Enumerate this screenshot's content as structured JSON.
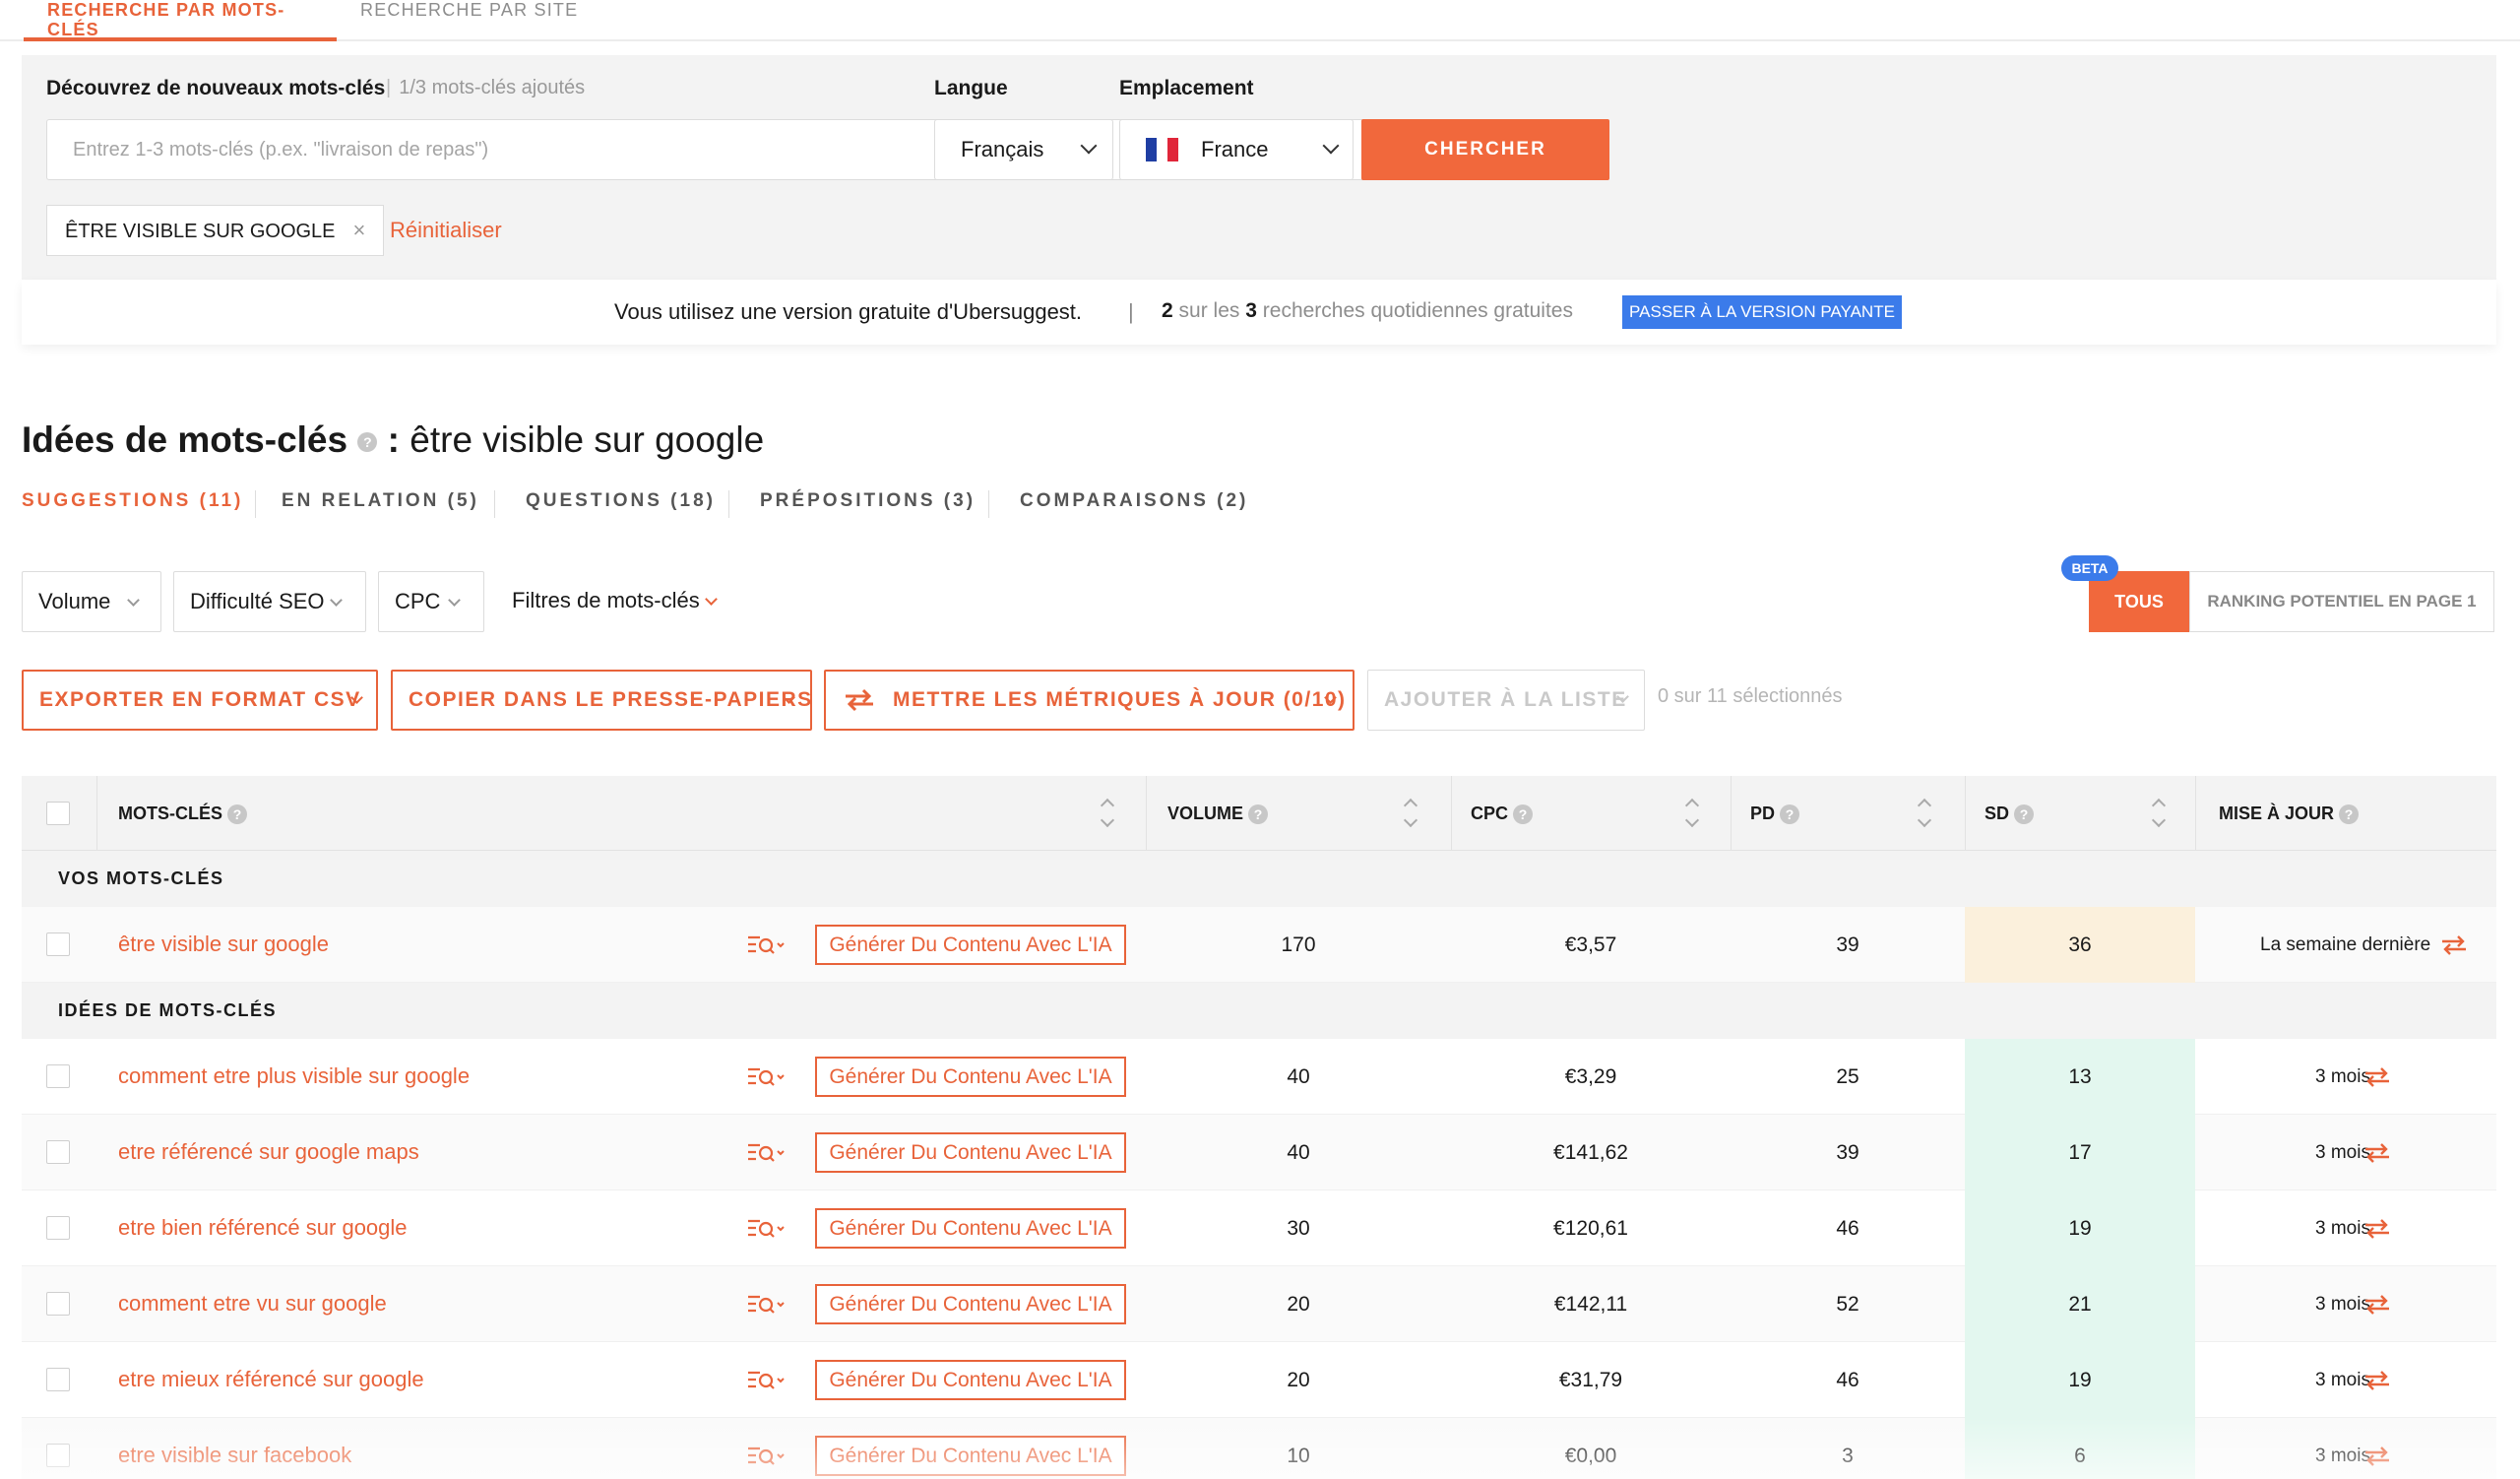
{
  "top_tabs": {
    "keywords": "RECHERCHE PAR MOTS-CLÉS",
    "site": "RECHERCHE PAR SITE"
  },
  "search": {
    "title": "Découvrez de nouveaux mots-clés",
    "count": "1/3 mots-clés ajoutés",
    "placeholder": "Entrez 1-3 mots-clés (p.ex. \"livraison de repas\")",
    "language_label": "Langue",
    "language_value": "Français",
    "location_label": "Emplacement",
    "location_value": "France",
    "search_button": "CHERCHER",
    "tag": "ÊTRE VISIBLE SUR GOOGLE",
    "tag_remove": "×",
    "reset": "Réinitialiser"
  },
  "free_bar": {
    "message": "Vous utilisez une version gratuite d'Ubersuggest.",
    "separator": "|",
    "used": "2",
    "on_the": "sur les",
    "total": "3",
    "suffix": "recherches quotidiennes gratuites",
    "upgrade": "PASSER À LA VERSION PAYANTE"
  },
  "ideas": {
    "title": "Idées de mots-clés",
    "colon": ":",
    "query": "être visible sur google",
    "tabs": [
      "SUGGESTIONS (11)",
      "EN RELATION (5)",
      "QUESTIONS (18)",
      "PRÉPOSITIONS (3)",
      "COMPARAISONS (2)"
    ]
  },
  "filters": {
    "volume": "Volume",
    "seo": "Difficulté SEO",
    "cpc": "CPC",
    "kw_filters": "Filtres de mots-clés",
    "beta": "BETA",
    "all": "TOUS",
    "ranking": "RANKING POTENTIEL EN PAGE 1"
  },
  "actions": {
    "export": "EXPORTER EN FORMAT CSV",
    "copy": "COPIER DANS LE PRESSE-PAPIERS",
    "update": "METTRE LES MÉTRIQUES À JOUR (0/10)",
    "add": "AJOUTER À LA LISTE",
    "selected": "0 sur 11 sélectionnés"
  },
  "table": {
    "headers": {
      "keywords": "MOTS-CLÉS",
      "volume": "VOLUME",
      "cpc": "CPC",
      "pd": "PD",
      "sd": "SD",
      "update": "MISE À JOUR"
    },
    "section_mine": "VOS MOTS-CLÉS",
    "section_ideas": "IDÉES DE MOTS-CLÉS",
    "generate_label": "Générer Du Contenu Avec L'IA",
    "mine": {
      "keyword": "être visible sur google",
      "volume": "170",
      "cpc": "€3,57",
      "pd": "39",
      "sd": "36",
      "updated": "La semaine dernière"
    },
    "rows": [
      {
        "keyword": "comment etre plus visible sur google",
        "volume": "40",
        "cpc": "€3,29",
        "pd": "25",
        "sd": "13",
        "updated": "3 mois"
      },
      {
        "keyword": "etre référencé sur google maps",
        "volume": "40",
        "cpc": "€141,62",
        "pd": "39",
        "sd": "17",
        "updated": "3 mois"
      },
      {
        "keyword": "etre bien référencé sur google",
        "volume": "30",
        "cpc": "€120,61",
        "pd": "46",
        "sd": "19",
        "updated": "3 mois"
      },
      {
        "keyword": "comment etre vu sur google",
        "volume": "20",
        "cpc": "€142,11",
        "pd": "52",
        "sd": "21",
        "updated": "3 mois"
      },
      {
        "keyword": "etre mieux référencé sur google",
        "volume": "20",
        "cpc": "€31,79",
        "pd": "46",
        "sd": "19",
        "updated": "3 mois"
      },
      {
        "keyword": "etre visible sur facebook",
        "volume": "10",
        "cpc": "€0,00",
        "pd": "3",
        "sd": "6",
        "updated": "3 mois"
      }
    ]
  },
  "colors": {
    "accent": "#e8633a",
    "blue": "#3b7bea",
    "sd_warm": "#fbf0dc",
    "sd_easy": "#e3f7ef"
  },
  "icons": [
    "plus-circle-icon",
    "chevron-down-icon",
    "france-flag-icon",
    "close-icon",
    "question-icon",
    "sort-icon",
    "search-list-icon",
    "refresh-icon"
  ]
}
